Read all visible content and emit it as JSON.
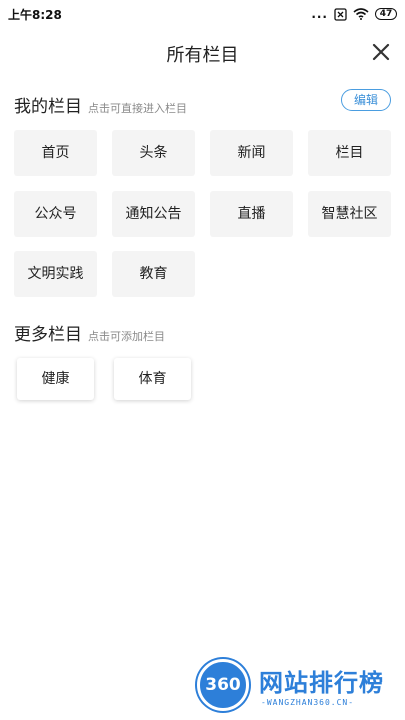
{
  "status_bar": {
    "time": "上午8:28",
    "dots": "...",
    "battery": "47"
  },
  "header": {
    "title": "所有栏目"
  },
  "my_section": {
    "title": "我的栏目",
    "hint": "点击可直接进入栏目",
    "edit_label": "编辑",
    "items": [
      "首页",
      "头条",
      "新闻",
      "栏目",
      "公众号",
      "通知公告",
      "直播",
      "智慧社区",
      "文明实践",
      "教育"
    ]
  },
  "more_section": {
    "title": "更多栏目",
    "hint": "点击可添加栏目",
    "items": [
      "健康",
      "体育"
    ]
  },
  "watermark": {
    "badge": "360",
    "name": "网站排行榜",
    "domain": "-WANGZHAN360.CN-"
  },
  "colors": {
    "accent": "#3a8fd8",
    "chip_bg": "#f4f4f4"
  }
}
